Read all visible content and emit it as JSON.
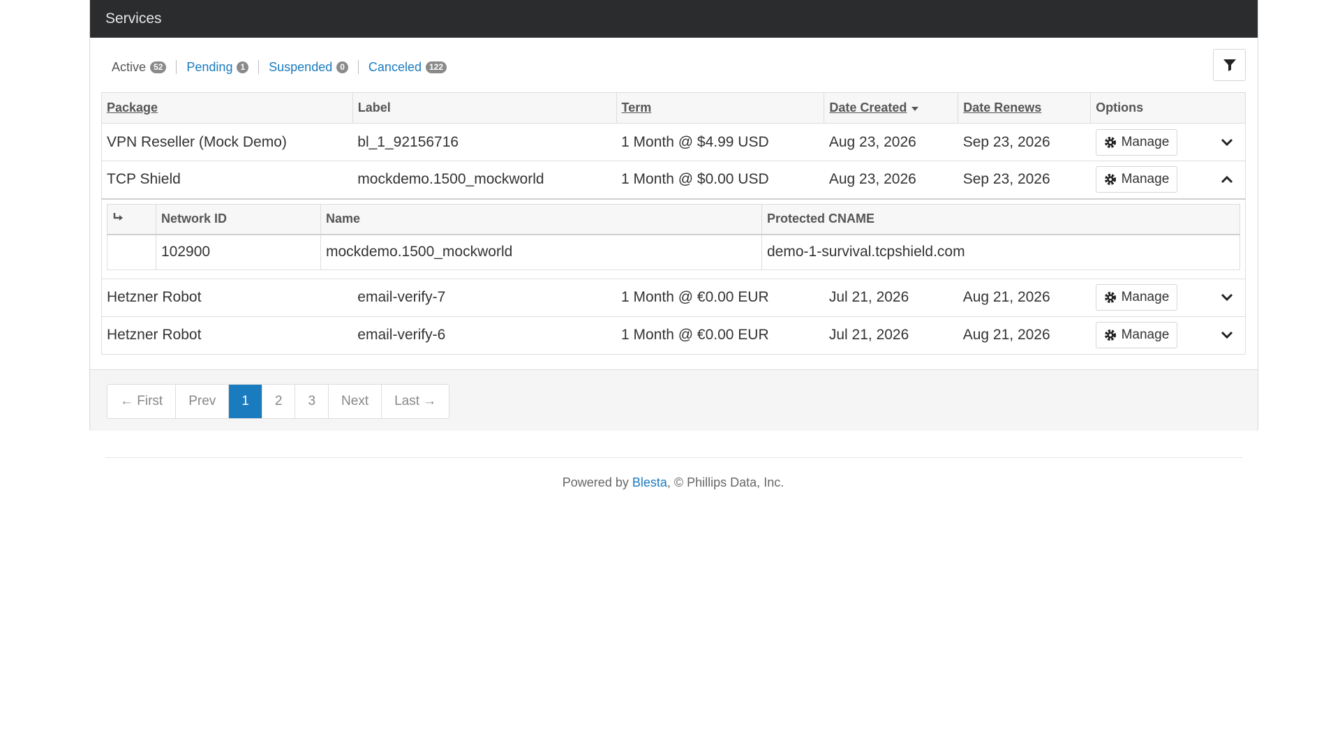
{
  "panel": {
    "title": "Services"
  },
  "status_tabs": [
    {
      "label": "Active",
      "count": "52"
    },
    {
      "label": "Pending",
      "count": "1"
    },
    {
      "label": "Suspended",
      "count": "0"
    },
    {
      "label": "Canceled",
      "count": "122"
    }
  ],
  "table": {
    "headers": {
      "package": "Package",
      "label": "Label",
      "term": "Term",
      "date_created": "Date Created",
      "date_renews": "Date Renews",
      "options": "Options"
    },
    "rows": [
      {
        "package": "VPN Reseller (Mock Demo)",
        "label": "bl_1_92156716",
        "term": "1 Month @ $4.99 USD",
        "date_created": "Aug 23, 2026",
        "date_renews": "Sep 23, 2026",
        "manage": "Manage"
      },
      {
        "package": "TCP Shield",
        "label": "mockdemo.1500_mockworld",
        "term": "1 Month @ $0.00 USD",
        "date_created": "Aug 23, 2026",
        "date_renews": "Sep 23, 2026",
        "manage": "Manage"
      },
      {
        "package": "Hetzner Robot",
        "label": "email-verify-7",
        "term": "1 Month @ €0.00 EUR",
        "date_created": "Jul 21, 2026",
        "date_renews": "Aug 21, 2026",
        "manage": "Manage"
      },
      {
        "package": "Hetzner Robot",
        "label": "email-verify-6",
        "term": "1 Month @ €0.00 EUR",
        "date_created": "Jul 21, 2026",
        "date_renews": "Aug 21, 2026",
        "manage": "Manage"
      }
    ]
  },
  "detail": {
    "headers": {
      "network_id": "Network ID",
      "name": "Name",
      "protected_cname": "Protected CNAME"
    },
    "row": {
      "network_id": "102900",
      "name": "mockdemo.1500_mockworld",
      "protected_cname": "demo-1-survival.tcpshield.com"
    }
  },
  "pagination": {
    "first": "← First",
    "prev": "Prev",
    "pages": [
      "1",
      "2",
      "3"
    ],
    "current": "1",
    "next": "Next",
    "last": "Last →"
  },
  "footer": {
    "prefix": "Powered by ",
    "link": "Blesta",
    "suffix": ", © Phillips Data, Inc."
  },
  "colors": {
    "accent": "#1a7bbf",
    "header_bg": "#2a2c2e"
  }
}
